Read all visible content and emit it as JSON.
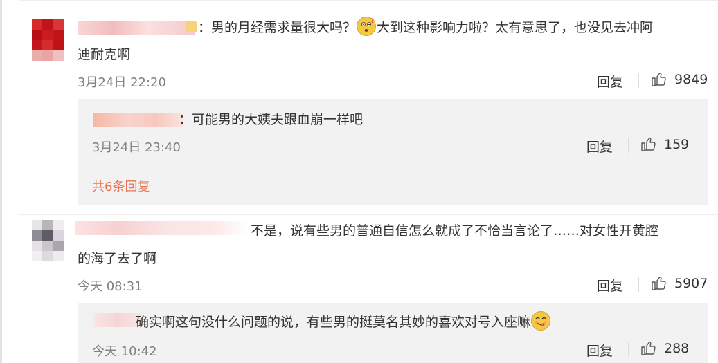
{
  "comments": [
    {
      "separator": "：",
      "text_before_emoji": "男的月经需求量很大吗？",
      "text_after_emoji_line1": "大到这种影响力啦？太有意思了，也没见去冲阿",
      "text_line2": "迪耐克啊",
      "time": "3月24日 22:20",
      "reply_label": "回复",
      "likes": "9849",
      "emoji_icon": "thinking-face-icon",
      "replies": [
        {
          "separator": "：",
          "text": "可能男的大姨夫跟血崩一样吧",
          "time": "3月24日 23:40",
          "reply_label": "回复",
          "likes": "159"
        }
      ],
      "more_replies": "共6条回复"
    },
    {
      "text_line1": "不是，说有些男的普通自信怎么就成了不恰当言论了……对女性开黄腔",
      "text_line2": "的海了去了啊",
      "time": "今天 08:31",
      "reply_label": "回复",
      "likes": "5907",
      "replies": [
        {
          "text": "确实啊这句没什么问题的说，有些男的挺莫名其妙的喜欢对号入座嘛",
          "emoji_icon": "yum-face-icon",
          "time": "今天 10:42",
          "reply_label": "回复",
          "likes": "288"
        }
      ]
    }
  ],
  "colors": {
    "link": "#eb7350",
    "time": "#808080",
    "sub_bg": "#f2f2f2",
    "avatar1": "#c0141b",
    "blur_name": "#f3c5c5"
  }
}
